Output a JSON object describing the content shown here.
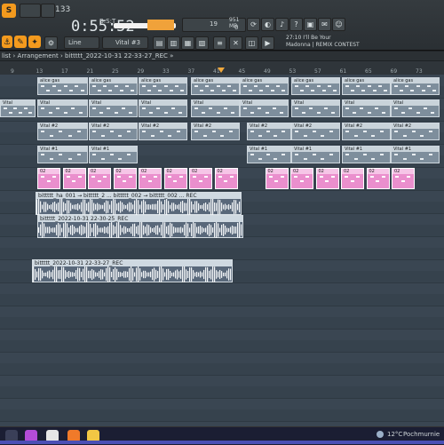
{
  "toolbar": {
    "tempo": "133",
    "time": "0:55:52",
    "bst": "B:S:T",
    "pattern_label": "Line",
    "channel_label": "Vital #3",
    "cpu_value": "19",
    "ram_value": "951 MB",
    "zero_value": "0",
    "hint_line1": "27:10 I’ll Be Your",
    "hint_line2": "Madonna | REMIX CONTEST"
  },
  "playlist": {
    "title": "list › Arrangement › bittttt_2022-10-31 22-33-27_REC »",
    "ruler": [
      "9",
      "13",
      "17",
      "21",
      "25",
      "29",
      "33",
      "37",
      "41",
      "45",
      "49",
      "53",
      "57",
      "61",
      "65",
      "69",
      "73"
    ]
  },
  "clips": {
    "alice_gas": "alice gas",
    "vital": "Vital",
    "vital2": "Vital #2",
    "vital1": "Vital #1",
    "pink_label": "02",
    "audio1": "bittttt_ha_001 → bittttt_2 ... bittttt_002 → bittttt_002 ... REC",
    "audio2": "bittttt_2022-10-31 22-30-25_REC",
    "audio3": "bittttt_2022-10-31 22-33-27_REC"
  },
  "taskbar": {
    "temperature": "12°C",
    "weather": "Pochmurnie"
  }
}
